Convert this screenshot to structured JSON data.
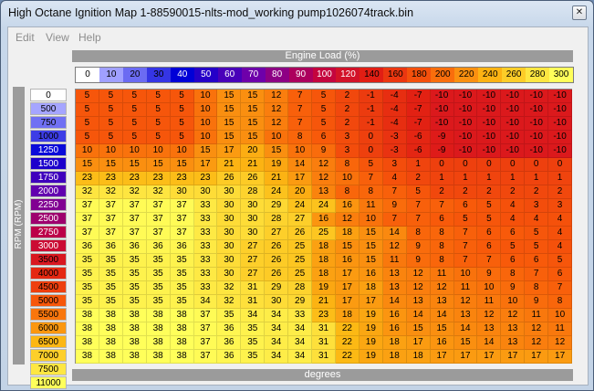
{
  "window": {
    "title": "High Octane Ignition Map 1-88590015-nlts-mod_working pump1026074track.bin",
    "close_glyph": "✕"
  },
  "menu": [
    {
      "label": "Edit"
    },
    {
      "label": "View"
    },
    {
      "label": "Help"
    }
  ],
  "table": {
    "x_axis_label": "Engine Load (%)",
    "y_axis_label": "RPM (RPM)",
    "footer_label": "degrees",
    "load_columns": [
      "0",
      "10",
      "20",
      "30",
      "40",
      "50",
      "60",
      "70",
      "80",
      "90",
      "100",
      "120",
      "140",
      "160",
      "180",
      "200",
      "220",
      "240",
      "260",
      "280",
      "300"
    ],
    "rpm_rows": [
      "0",
      "500",
      "750",
      "1000",
      "1250",
      "1500",
      "1750",
      "2000",
      "2250",
      "2500",
      "2750",
      "3000",
      "3500",
      "4000",
      "4500",
      "5000",
      "5500",
      "6000",
      "6500",
      "7000",
      "7500",
      "11000"
    ],
    "values": [
      [
        5,
        5,
        5,
        5,
        5,
        10,
        15,
        15,
        12,
        7,
        5,
        2,
        -1,
        -4,
        -7,
        -10,
        -10,
        -10,
        -10,
        -10,
        -10
      ],
      [
        5,
        5,
        5,
        5,
        5,
        10,
        15,
        15,
        12,
        7,
        5,
        2,
        -1,
        -4,
        -7,
        -10,
        -10,
        -10,
        -10,
        -10,
        -10
      ],
      [
        5,
        5,
        5,
        5,
        5,
        10,
        15,
        15,
        12,
        7,
        5,
        2,
        -1,
        -4,
        -7,
        -10,
        -10,
        -10,
        -10,
        -10,
        -10
      ],
      [
        5,
        5,
        5,
        5,
        5,
        10,
        15,
        15,
        10,
        8,
        6,
        3,
        0,
        -3,
        -6,
        -9,
        -10,
        -10,
        -10,
        -10,
        -10
      ],
      [
        10,
        10,
        10,
        10,
        10,
        15,
        17,
        20,
        15,
        10,
        9,
        3,
        0,
        -3,
        -6,
        -9,
        -10,
        -10,
        -10,
        -10,
        -10
      ],
      [
        15,
        15,
        15,
        15,
        15,
        17,
        21,
        21,
        19,
        14,
        12,
        8,
        5,
        3,
        1,
        0,
        0,
        0,
        0,
        0,
        0
      ],
      [
        23,
        23,
        23,
        23,
        23,
        23,
        26,
        26,
        21,
        17,
        12,
        10,
        7,
        4,
        2,
        1,
        1,
        1,
        1,
        1,
        1
      ],
      [
        32,
        32,
        32,
        32,
        30,
        30,
        30,
        28,
        24,
        20,
        13,
        8,
        8,
        7,
        5,
        2,
        2,
        2,
        2,
        2,
        2
      ],
      [
        37,
        37,
        37,
        37,
        37,
        33,
        30,
        30,
        29,
        24,
        24,
        16,
        11,
        9,
        7,
        7,
        6,
        5,
        4,
        3,
        3
      ],
      [
        37,
        37,
        37,
        37,
        37,
        33,
        30,
        30,
        28,
        27,
        16,
        12,
        10,
        7,
        7,
        6,
        5,
        5,
        4,
        4,
        4
      ],
      [
        37,
        37,
        37,
        37,
        37,
        33,
        30,
        30,
        27,
        26,
        25,
        18,
        15,
        14,
        8,
        8,
        7,
        6,
        6,
        5,
        4
      ],
      [
        36,
        36,
        36,
        36,
        36,
        33,
        30,
        27,
        26,
        25,
        18,
        15,
        15,
        12,
        9,
        8,
        7,
        6,
        5,
        5,
        4
      ],
      [
        35,
        35,
        35,
        35,
        35,
        33,
        30,
        27,
        26,
        25,
        18,
        16,
        15,
        11,
        9,
        8,
        7,
        7,
        6,
        6,
        5
      ],
      [
        35,
        35,
        35,
        35,
        35,
        33,
        30,
        27,
        26,
        25,
        18,
        17,
        16,
        13,
        12,
        11,
        10,
        9,
        8,
        7,
        6
      ],
      [
        35,
        35,
        35,
        35,
        35,
        33,
        32,
        31,
        29,
        28,
        19,
        17,
        18,
        13,
        12,
        12,
        11,
        10,
        9,
        8,
        7
      ],
      [
        35,
        35,
        35,
        35,
        35,
        34,
        32,
        31,
        30,
        29,
        21,
        17,
        17,
        14,
        13,
        13,
        12,
        11,
        10,
        9,
        8
      ],
      [
        38,
        38,
        38,
        38,
        38,
        37,
        35,
        34,
        34,
        33,
        23,
        18,
        19,
        16,
        14,
        14,
        13,
        12,
        12,
        11,
        10
      ],
      [
        38,
        38,
        38,
        38,
        38,
        37,
        36,
        35,
        34,
        34,
        31,
        22,
        19,
        16,
        15,
        15,
        14,
        13,
        13,
        12,
        11
      ],
      [
        38,
        38,
        38,
        38,
        38,
        37,
        36,
        35,
        34,
        34,
        31,
        22,
        19,
        18,
        17,
        16,
        15,
        14,
        13,
        12,
        12
      ],
      [
        38,
        38,
        38,
        38,
        38,
        37,
        36,
        35,
        34,
        34,
        31,
        22,
        19,
        18,
        18,
        17,
        17,
        17,
        17,
        17,
        17
      ]
    ]
  },
  "colors": {
    "title_bar": "#c7d7ea",
    "header_bar": "#9b9b9b",
    "legend_low": "#0000c8",
    "legend_mid": "#cc0000",
    "legend_high": "#ffff40"
  }
}
